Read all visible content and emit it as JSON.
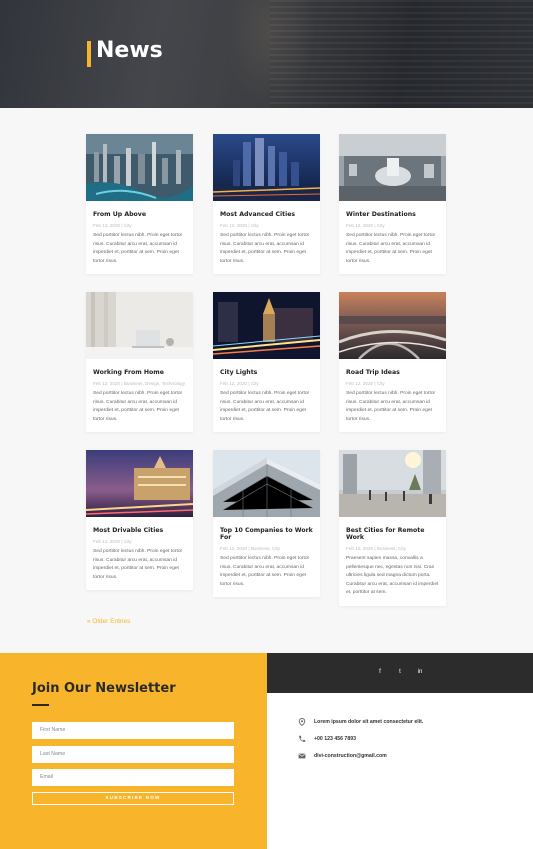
{
  "hero": {
    "title": "News"
  },
  "posts": [
    {
      "title": "From Up Above",
      "meta": "Feb 12, 2020 | City",
      "excerpt": "Sed porttitor lectus nibh. Proin eget tortor risus. Curabitur arcu erat, accumsan id imperdiet et, porttitor at sem. Proin eget tortor risus."
    },
    {
      "title": "Most Advanced Cities",
      "meta": "Feb 12, 2020 | City",
      "excerpt": "Sed porttitor lectus nibh. Proin eget tortor risus. Curabitur arcu erat, accumsan id imperdiet et, porttitor at sem. Proin eget tortor risus."
    },
    {
      "title": "Winter Destinations",
      "meta": "Feb 12, 2020 | City",
      "excerpt": "Sed porttitor lectus nibh. Proin eget tortor risus. Curabitur arcu erat, accumsan id imperdiet et, porttitor at sem. Proin eget tortor risus."
    },
    {
      "title": "Working From Home",
      "meta": "Feb 12, 2020 | Business, Design, Technology",
      "excerpt": "Sed porttitor lectus nibh. Proin eget tortor risus. Curabitur arcu erat, accumsan id imperdiet et, porttitor at sem. Proin eget tortor risus."
    },
    {
      "title": "City Lights",
      "meta": "Feb 12, 2020 | City",
      "excerpt": "Sed porttitor lectus nibh. Proin eget tortor risus. Curabitur arcu erat, accumsan id imperdiet et, porttitor at sem. Proin eget tortor risus."
    },
    {
      "title": "Road Trip Ideas",
      "meta": "Feb 12, 2020 | City",
      "excerpt": "Sed porttitor lectus nibh. Proin eget tortor risus. Curabitur arcu erat, accumsan id imperdiet et, porttitor at sem. Proin eget tortor risus."
    },
    {
      "title": "Most Drivable Cities",
      "meta": "Feb 12, 2020 | City",
      "excerpt": "Sed porttitor lectus nibh. Proin eget tortor risus. Curabitur arcu erat, accumsan id imperdiet et, porttitor at sem. Proin eget tortor risus."
    },
    {
      "title": "Top 10 Companies to Work For",
      "meta": "Feb 12, 2020 | Business, City",
      "excerpt": "Sed porttitor lectus nibh. Proin eget tortor risus. Curabitur arcu erat, accumsan id imperdiet et, porttitor at sem. Proin eget tortor risus."
    },
    {
      "title": "Best Cities for Remote Work",
      "meta": "Feb 12, 2020 | Business, City",
      "excerpt": "Praesent sapien massa, convallis a pellentesque nec, egestas non nisi. Cras ultricies ligula sed magna dictum porta. Curabitur arcu erat, accumsan id imperdiet et, porttitor at sem."
    }
  ],
  "pagination": {
    "older": "« Older Entries"
  },
  "newsletter": {
    "title": "Join Our Newsletter",
    "first_name_placeholder": "First Name",
    "last_name_placeholder": "Last Name",
    "email_placeholder": "Email",
    "subscribe_label": "SUBSCRIBE NOW"
  },
  "social": {
    "facebook": "f",
    "twitter": "t",
    "linkedin": "in"
  },
  "contact": {
    "address": "Lorem ipsum dolor sit amet consectetur elit.",
    "phone": "+00 123 456 7893",
    "email": "divi-construction@gmail.com"
  },
  "colors": {
    "accent": "#f8b52b",
    "dark": "#2c2c2c"
  }
}
